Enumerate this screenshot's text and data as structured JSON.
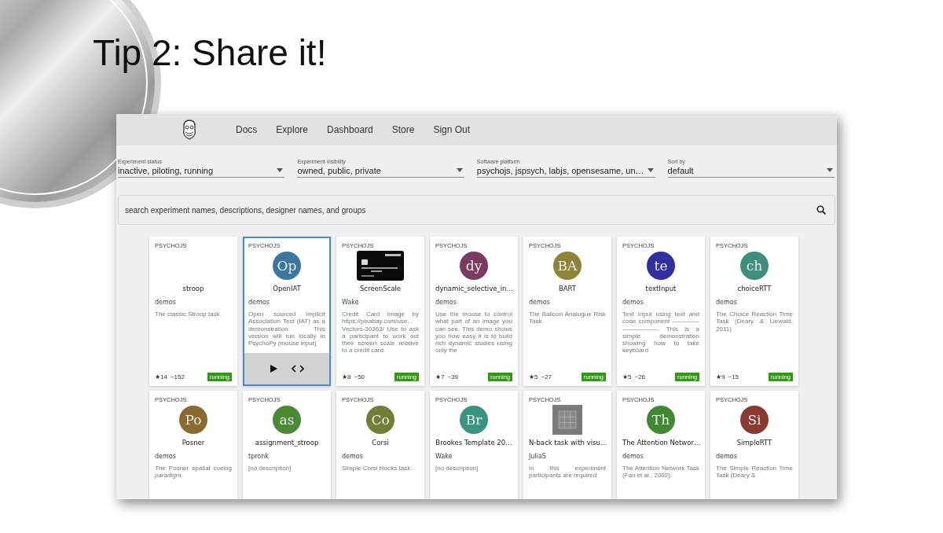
{
  "slide": {
    "title": "Tip 2: Share it!"
  },
  "nav": {
    "links": [
      "Docs",
      "Explore",
      "Dashboard",
      "Store",
      "Sign Out"
    ]
  },
  "filters": [
    {
      "label": "Experiment status",
      "value": "inactive, piloting, running"
    },
    {
      "label": "Experiment visibility",
      "value": "owned, public, private"
    },
    {
      "label": "Software platform",
      "value": "psychojs, jspsych, labjs, opensesame, un…"
    },
    {
      "label": "Sort by",
      "value": "default"
    }
  ],
  "search": {
    "placeholder": "search experiment names, descriptions, designer names, and groups"
  },
  "cards": [
    {
      "platform": "PSYCHOJS",
      "avatar": {
        "kind": "none"
      },
      "title": "stroop",
      "owner": "demos",
      "description": "The classic Stroop task.",
      "stars": "★14",
      "views": "~152",
      "status": "running",
      "selected": false
    },
    {
      "platform": "PSYCHOJS",
      "avatar": {
        "kind": "initials",
        "text": "Op",
        "color": "#3b77a0"
      },
      "title": "OpenIAT",
      "owner": "demos",
      "description": "Open sourced Implicit Association Test (IAT) as a demonstration. This version will run locally in PsychoPy (mouse input)",
      "selected": true
    },
    {
      "platform": "PSYCHOJS",
      "avatar": {
        "kind": "cardimage"
      },
      "title": "ScreenScale",
      "owner": "Wake",
      "description": "Credit Card Image by https://pixabay.com/use... Vectors-30363/ Use to ask a participant to work out their screen scale relative to a credit card.",
      "stars": "★8",
      "views": "~50",
      "status": "running",
      "selected": false
    },
    {
      "platform": "PSYCHOJS",
      "avatar": {
        "kind": "initials",
        "text": "dy",
        "color": "#7a3a62"
      },
      "title": "dynamic_selective_in…",
      "owner": "demos",
      "description": "Use the mouse to control what part of an image you can see. This demo shows you how easy it is to build rich dynamic studies using only the",
      "stars": "★7",
      "views": "~39",
      "status": "running",
      "selected": false
    },
    {
      "platform": "PSYCHOJS",
      "avatar": {
        "kind": "initials",
        "text": "BA",
        "color": "#8c8436"
      },
      "title": "BART",
      "owner": "demos",
      "description": "The Balloon Analogue Risk Task",
      "stars": "★5",
      "views": "~27",
      "status": "running",
      "selected": false
    },
    {
      "platform": "PSYCHOJS",
      "avatar": {
        "kind": "initials",
        "text": "te",
        "color": "#3030a0"
      },
      "title": "textInput",
      "owner": "demos",
      "description": "Text Input using text and code component ------------------------------. This is a simple demonstration showing how to take keyboard",
      "stars": "★5",
      "views": "~26",
      "status": "running",
      "selected": false
    },
    {
      "platform": "PSYCHOJS",
      "avatar": {
        "kind": "initials",
        "text": "ch",
        "color": "#3f8f80"
      },
      "title": "choiceRTT",
      "owner": "demos",
      "description": "The Choice Reaction Time Task (Deary & Liewald, 2011)",
      "stars": "★9",
      "views": "~15",
      "status": "running",
      "selected": false
    },
    {
      "platform": "PSYCHOJS",
      "avatar": {
        "kind": "initials",
        "text": "Po",
        "color": "#8a6a2e"
      },
      "title": "Posner",
      "owner": "demos",
      "description": "The Posner spatial cueing paradigm.",
      "selected": false
    },
    {
      "platform": "PSYCHOJS",
      "avatar": {
        "kind": "initials",
        "text": "as",
        "color": "#4a8a36"
      },
      "title": "assignment_stroop",
      "owner": "tpronk",
      "description": "[no description]",
      "selected": false
    },
    {
      "platform": "PSYCHOJS",
      "avatar": {
        "kind": "initials",
        "text": "Co",
        "color": "#6f7f36"
      },
      "title": "Corsi",
      "owner": "demos",
      "description": "Simple Corsi blocks task.",
      "selected": false
    },
    {
      "platform": "PSYCHOJS",
      "avatar": {
        "kind": "initials",
        "text": "Br",
        "color": "#3a9482"
      },
      "title": "Brookes Template 20…",
      "owner": "Wake",
      "description": "[no description]",
      "selected": false
    },
    {
      "platform": "PSYCHOJS",
      "avatar": {
        "kind": "gridimage"
      },
      "title": "N-back task with visu…",
      "owner": "JuliaS",
      "description": "In this experiment participants are required",
      "selected": false
    },
    {
      "platform": "PSYCHOJS",
      "avatar": {
        "kind": "initials",
        "text": "Th",
        "color": "#3f8a30"
      },
      "title": "The Attention Networ…",
      "owner": "demos",
      "description": "The Attention Network Task (Fan et al., 2002).",
      "selected": false
    },
    {
      "platform": "PSYCHOJS",
      "avatar": {
        "kind": "initials",
        "text": "Si",
        "color": "#8a3a30"
      },
      "title": "SimpleRTT",
      "owner": "demos",
      "description": "The Simple Reaction Time Task (Deary &",
      "selected": false
    }
  ]
}
